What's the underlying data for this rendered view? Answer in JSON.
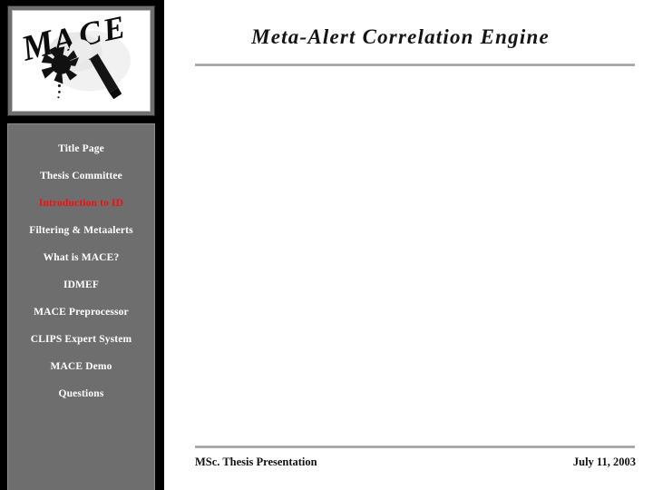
{
  "logo": {
    "wordmark": "MACE",
    "icon_name": "mace-weapon-icon",
    "alt": "MACE logo"
  },
  "header": {
    "title": "Meta-Alert Correlation Engine"
  },
  "sidebar": {
    "items": [
      {
        "label": "Title Page",
        "active": false
      },
      {
        "label": "Thesis Committee",
        "active": false
      },
      {
        "label": "Introduction to ID",
        "active": true
      },
      {
        "label": "Filtering & Metaalerts",
        "active": false
      },
      {
        "label": "What is MACE?",
        "active": false
      },
      {
        "label": "IDMEF",
        "active": false
      },
      {
        "label": "MACE Preprocessor",
        "active": false
      },
      {
        "label": "CLIPS Expert System",
        "active": false
      },
      {
        "label": "MACE Demo",
        "active": false
      },
      {
        "label": "Questions",
        "active": false
      }
    ]
  },
  "footer": {
    "left": "MSc. Thesis Presentation",
    "right": "July 11, 2003"
  },
  "colors": {
    "sidebar_bg": "#6e6e6e",
    "sidebar_text": "#ffffff",
    "active_text": "#fb0b0b",
    "rule": "#9a9a9a",
    "page_bg": "#ffffff",
    "ink": "#111111"
  }
}
